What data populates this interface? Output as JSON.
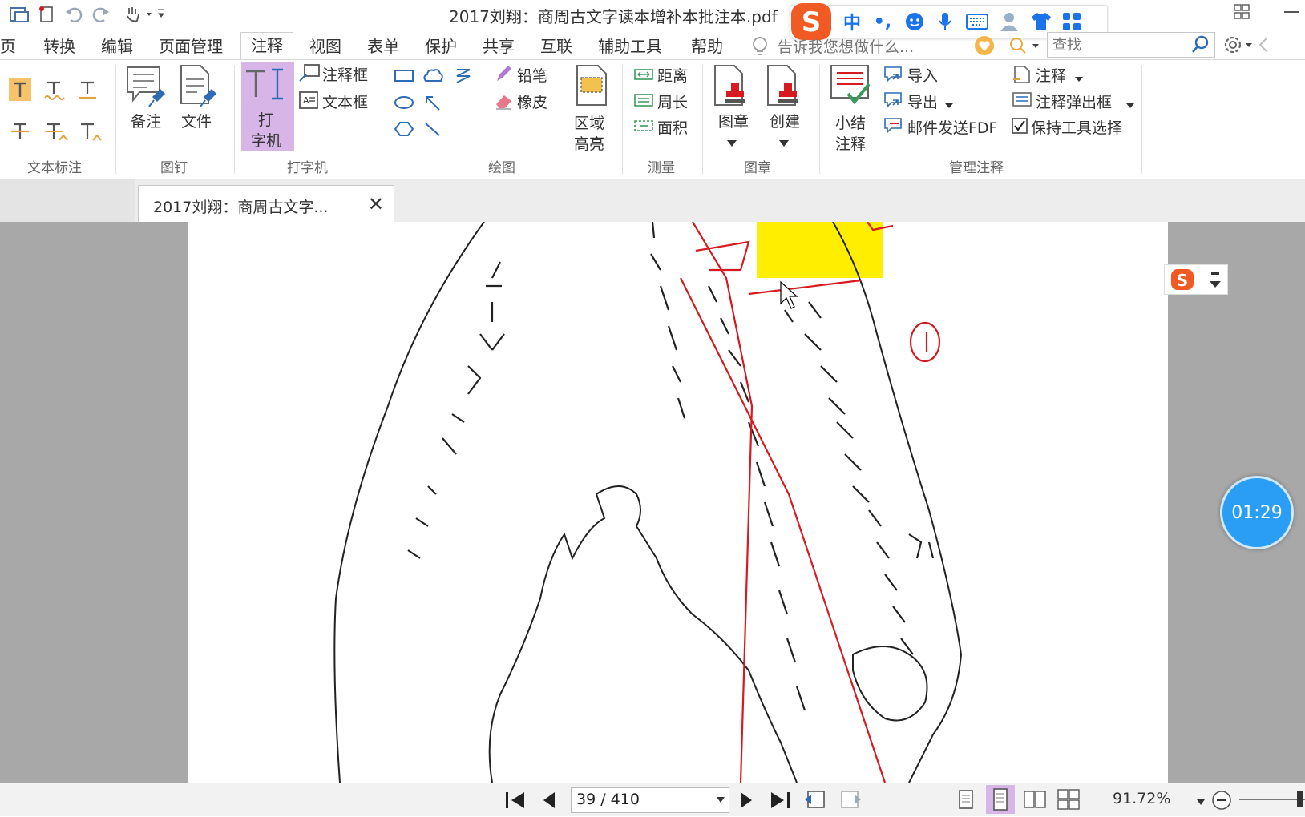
{
  "title_bar": {
    "document_title": "2017刘翔：商周古文字读本增补本批注本.pdf"
  },
  "menu": {
    "items": [
      "页",
      "转换",
      "编辑",
      "页面管理",
      "注释",
      "视图",
      "表单",
      "保护",
      "共享",
      "互联",
      "辅助工具",
      "帮助"
    ],
    "active": "注释",
    "tell_me": "告诉我您想做什么...",
    "search_placeholder": "查找"
  },
  "ribbon": {
    "groups": {
      "text_markup": "文本标注",
      "pin": "图钉",
      "typewriter": "打字机",
      "drawing": "绘图",
      "measure": "测量",
      "stamp": "图章",
      "manage": "管理注释"
    },
    "buttons": {
      "note": "备注",
      "file": "文件",
      "typewriter_1": "打",
      "typewriter_2": "字机",
      "callout": "注释框",
      "textbox": "文本框",
      "pencil": "铅笔",
      "eraser": "橡皮",
      "area_hl_1": "区域",
      "area_hl_2": "高亮",
      "distance": "距离",
      "perimeter": "周长",
      "area": "面积",
      "stamp": "图章",
      "create": "创建",
      "summary_1": "小结",
      "summary_2": "注释",
      "import": "导入",
      "export": "导出",
      "email_fdf": "邮件发送FDF",
      "comments": "注释",
      "comment_popup": "注释弹出框",
      "keep_tool": "保持工具选择"
    }
  },
  "doc_tab": {
    "label": "2017刘翔：商周古文字..."
  },
  "timer": "01:29",
  "statusbar": {
    "page": "39 / 410",
    "zoom": "91.72%"
  },
  "colors": {
    "accent": "#c8a4dc",
    "highlight": "#ffee00",
    "annotation_red": "#d71920",
    "ime_blue": "#1a73e8",
    "timer": "#2a9df4"
  }
}
